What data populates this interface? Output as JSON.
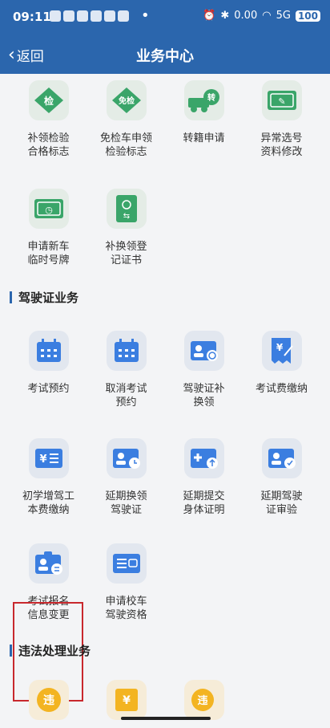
{
  "status_bar": {
    "time": "09:11",
    "dot": "•",
    "network": "0.00",
    "signal": "5G",
    "battery": "100"
  },
  "nav": {
    "back_label": "返回",
    "title": "业务中心"
  },
  "vehicle_items": [
    {
      "icon": "inspection-badge-icon",
      "glyph": "检",
      "label": "补领检验\n合格标志"
    },
    {
      "icon": "exemption-badge-icon",
      "glyph": "免检",
      "label": "免检车申领\n检验标志"
    },
    {
      "icon": "transfer-truck-icon",
      "glyph": "转",
      "label": "转籍申请"
    },
    {
      "icon": "plate-edit-icon",
      "glyph": "✎",
      "label": "异常选号\n资料修改"
    },
    {
      "icon": "temporary-plate-icon",
      "glyph": "◷",
      "label": "申请新车\n临时号牌"
    },
    {
      "icon": "registration-book-icon",
      "glyph": "⇆",
      "label": "补换领登\n记证书"
    }
  ],
  "license_section": {
    "title": "驾驶证业务"
  },
  "license_items": [
    {
      "icon": "calendar-icon",
      "label": "考试预约"
    },
    {
      "icon": "calendar-cancel-icon",
      "label": "取消考试\n预约"
    },
    {
      "icon": "license-renew-icon",
      "label": "驾驶证补\n换领"
    },
    {
      "icon": "fee-receipt-icon",
      "glyph": "¥",
      "label": "考试费缴纳"
    },
    {
      "icon": "yuan-list-icon",
      "glyph": "¥",
      "label": "初学增驾工\n本费缴纳"
    },
    {
      "icon": "license-clock-icon",
      "label": "延期换领\n驾驶证"
    },
    {
      "icon": "health-upload-icon",
      "label": "延期提交\n身体证明"
    },
    {
      "icon": "license-check-icon",
      "label": "延期驾驶\n证审验"
    },
    {
      "icon": "exam-info-change-icon",
      "label": "考试报名\n信息变更"
    },
    {
      "icon": "school-bus-icon",
      "label": "申请校车\n驾驶资格"
    }
  ],
  "violation_section": {
    "title": "违法处理业务"
  },
  "violation_items": [
    {
      "icon": "violation-icon",
      "glyph": "违"
    },
    {
      "icon": "fine-payment-icon",
      "glyph": "¥"
    },
    {
      "icon": "violation-handle-icon",
      "glyph": "违"
    }
  ]
}
